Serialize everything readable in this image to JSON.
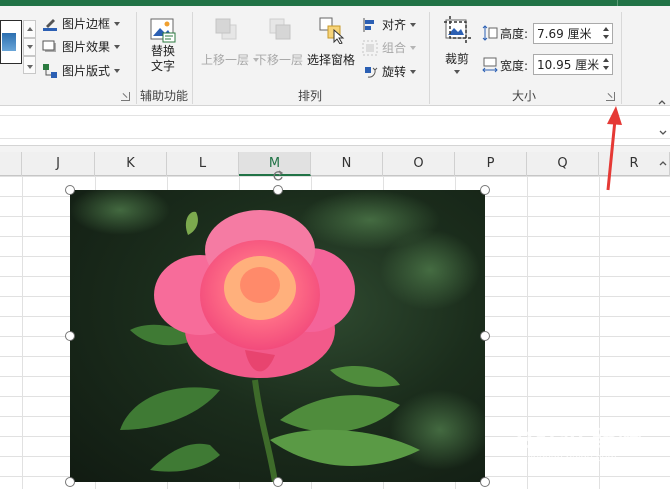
{
  "ribbon": {
    "picture_styles": {
      "border_label": "图片边框",
      "effects_label": "图片效果",
      "layout_label": "图片版式"
    },
    "accessibility": {
      "alt_text_label_line1": "替换",
      "alt_text_label_line2": "文字",
      "group_label": "辅助功能"
    },
    "arrange": {
      "bring_forward_label": "上移一层",
      "send_backward_label": "下移一层",
      "selection_pane_label": "选择窗格",
      "align_label": "对齐",
      "group_label_btn": "组合",
      "rotate_label": "旋转",
      "group_label": "排列"
    },
    "size": {
      "crop_label": "裁剪",
      "height_label": "高度:",
      "height_value": "7.69 厘米",
      "width_label": "宽度:",
      "width_value": "10.95 厘米",
      "group_label": "大小"
    }
  },
  "columns": [
    "J",
    "K",
    "L",
    "M",
    "N",
    "O",
    "P",
    "Q",
    "R"
  ],
  "selected_column": "M",
  "colors": {
    "excel_green": "#217346",
    "annotation_red": "#e53935"
  },
  "watermark": {
    "main": "Bai∂u 经验",
    "sub": "jingyan.baidu.com"
  }
}
